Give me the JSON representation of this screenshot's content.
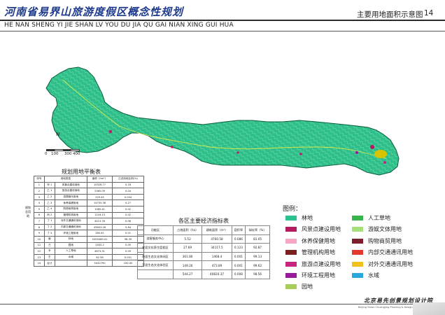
{
  "header": {
    "title": "河南省易界山旅游度假区概念性规划",
    "subtitle": "主要用地面积示意图",
    "page_number": "14",
    "pinyin": "HE NAN SHENG YI JIE SHAN LV YOU DU JIA QU GAI NIAN XING GUI HUA"
  },
  "map": {
    "scale_labels": [
      "0",
      "100",
      "300",
      "400"
    ],
    "north": "N",
    "colors": {
      "forest": "#2fbf8a",
      "contour": "#7fe2b4",
      "border": "#0b5d3c",
      "road": "#d7e84a",
      "poi": "#c01a6a",
      "water": "#d7c400"
    }
  },
  "land_table": {
    "title": "规划用地平衡表",
    "headers": [
      "序号",
      "用地类型",
      "面积（hm²）",
      "占总用地比例(%)"
    ],
    "group_label": "规划总用地",
    "rows": [
      [
        "1",
        "甲 1",
        "风景点建设用地",
        "10328.77",
        "0.18"
      ],
      [
        "2",
        "乙 1",
        "旅游点建设用地",
        "2365.09",
        "0.04"
      ],
      [
        "3",
        "乙 2",
        "游憩娱乐用地",
        "229.45",
        "0.004"
      ],
      [
        "4",
        "乙 3",
        "休养保健用地",
        "14705.38",
        "0.27"
      ],
      [
        "5",
        "乙 4",
        "购物商贸用地",
        "1085.41",
        "0.02"
      ],
      [
        "6",
        "丙 2",
        "管理机构用地",
        "1216.13",
        "0.02"
      ],
      [
        "7",
        "丁 1",
        "对外交通通讯用地",
        "4413.78",
        "0.08"
      ],
      [
        "8",
        "丁 2",
        "内部交通通讯用地",
        "45603.26",
        "0.84"
      ],
      [
        "9",
        "丁 3",
        "环境工程用地",
        "280.61",
        "0.01"
      ],
      [
        "10",
        "庚",
        "林地",
        "5355089.41",
        "98.39"
      ],
      [
        "11",
        "己",
        "园地",
        "2405.2",
        "0.05"
      ],
      [
        "12",
        "辛",
        "人工草地",
        "4873.31",
        "0.09"
      ],
      [
        "13",
        "壬",
        "水域",
        "62.56",
        "0.001"
      ],
      [
        "14",
        "合计",
        "",
        "5442790",
        "100.00"
      ]
    ]
  },
  "econ_table": {
    "title": "各区主要经济指标表",
    "headers": [
      "功能区",
      "占地面积（ha）",
      "建筑面积（m²）",
      "容积率",
      "绿化率（%）"
    ],
    "rows": [
      [
        "游客服务中心",
        "5.52",
        "4760.58",
        "0.086",
        "81.05"
      ],
      [
        "安居文化养生度假区",
        "27.69",
        "34117.5",
        "0.123",
        "92.87"
      ],
      [
        "隐居生态文化休闲区",
        "361.80",
        "1468.4",
        "0.001",
        "99.13"
      ],
      [
        "不居生态文化体验区",
        "149.26",
        "473.89",
        "0.001",
        "99.62"
      ],
      [
        "",
        "544.27",
        "40820.37",
        "0.008",
        "98.56"
      ]
    ]
  },
  "legend": {
    "title": "图例：",
    "items": [
      {
        "label": "林地",
        "color": "#2dc18f"
      },
      {
        "label": "人工草地",
        "color": "#36b54a"
      },
      {
        "label": "风景点建设用地",
        "color": "#b5195f"
      },
      {
        "label": "游娱文体用地",
        "color": "#a6e07a"
      },
      {
        "label": "休养保健用地",
        "color": "#f6a6c6"
      },
      {
        "label": "购物商贸用地",
        "color": "#7a1f2b"
      },
      {
        "label": "管理机构用地",
        "color": "#7a2222"
      },
      {
        "label": "内部交通通讯用地",
        "color": "#e23a2e"
      },
      {
        "label": "旅游点建设用地",
        "color": "#c8237e"
      },
      {
        "label": "对外交通通讯用地",
        "color": "#f3c11c"
      },
      {
        "label": "环境工程用地",
        "color": "#9a1a9c"
      },
      {
        "label": "水域",
        "color": "#29a8dc"
      },
      {
        "label": "园地",
        "color": "#a9cd5a"
      }
    ]
  },
  "footer": {
    "institute": "北京易先创景规划设计院",
    "institute_en": "Beijing Yixian Chuangjing Planning & Design Institute"
  }
}
